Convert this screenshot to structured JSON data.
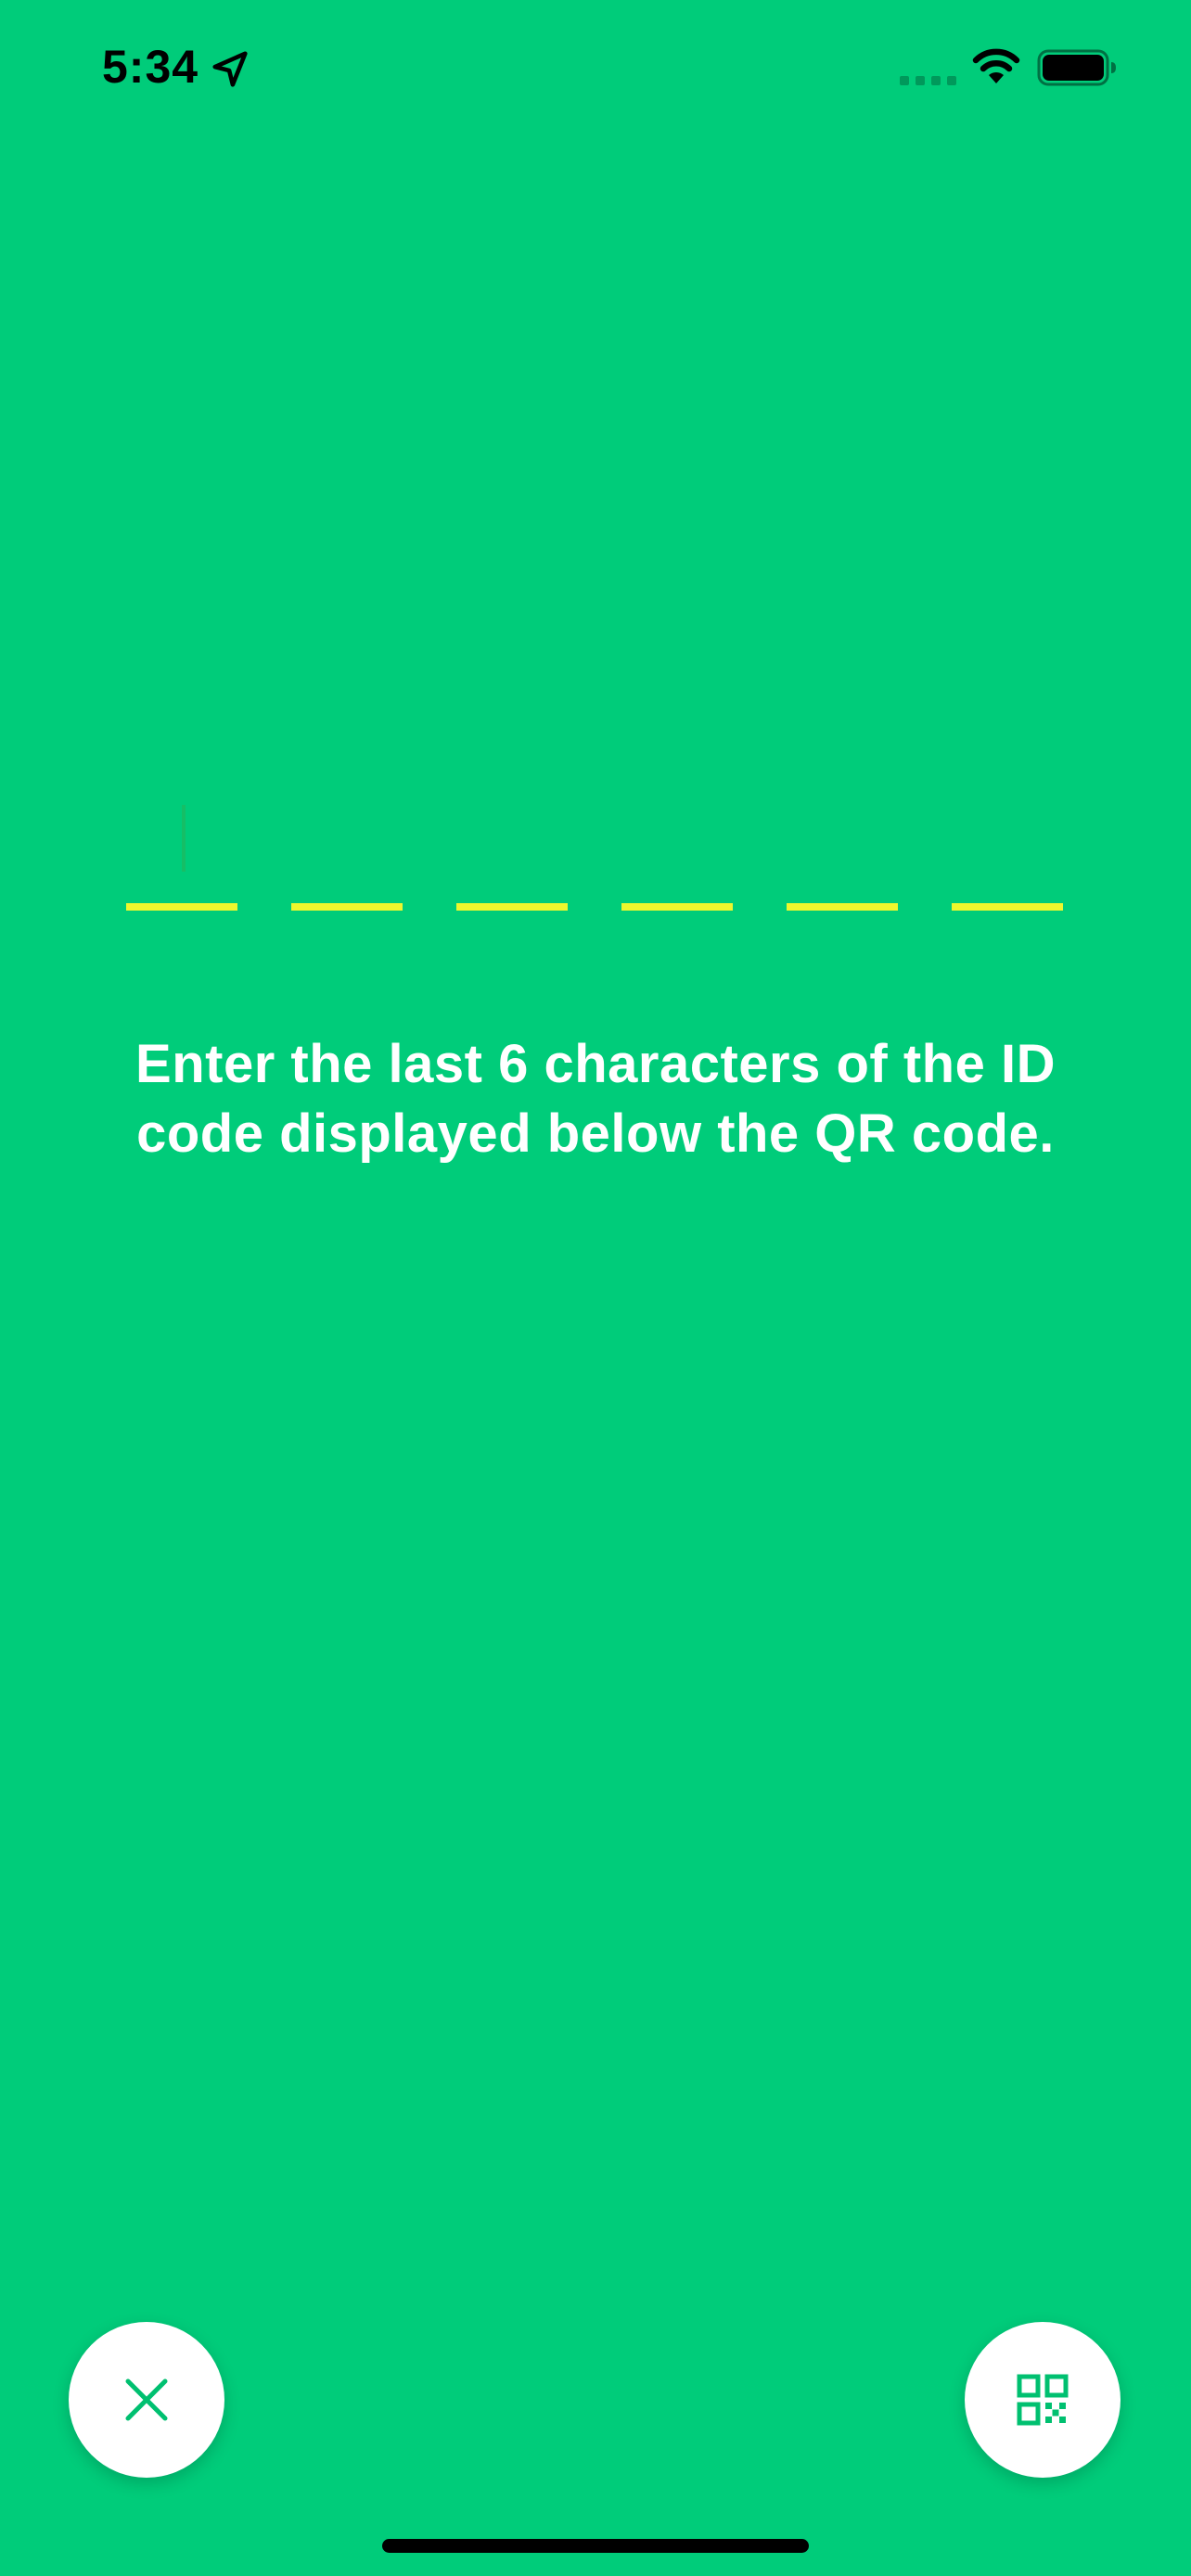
{
  "status_bar": {
    "time": "5:34",
    "icons": [
      "location-arrow-icon",
      "cellular-signal-icon",
      "wifi-icon",
      "battery-icon"
    ]
  },
  "code_input": {
    "slot_count": 6,
    "values": [
      "",
      "",
      "",
      "",
      "",
      ""
    ]
  },
  "instruction": {
    "text": "Enter the last 6 characters of the ID code displayed below the QR code."
  },
  "actions": {
    "close_icon": "close-icon",
    "scan_icon": "qr-code-icon"
  },
  "colors": {
    "background": "#00CC7A",
    "slot_underline": "#EEF72D",
    "text": "#FFFFFF",
    "button_background": "#FFFFFF",
    "button_icon": "#00C070"
  }
}
